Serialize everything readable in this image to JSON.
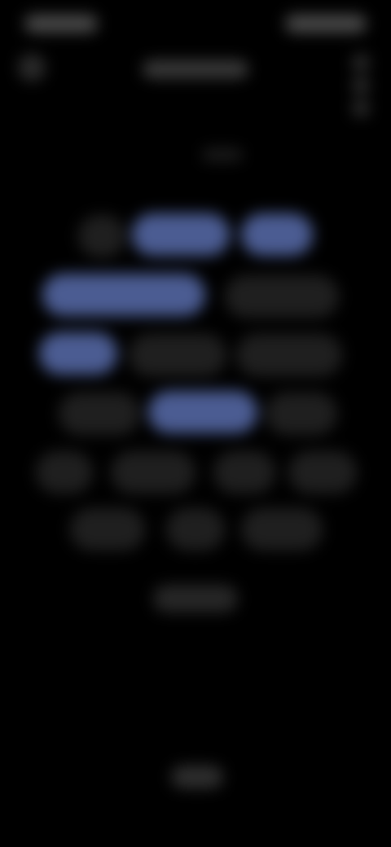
{
  "colors": {
    "background": "#000000",
    "selected_chip": "#4b5c92",
    "unselected_chip": "#1f1f1f"
  },
  "icons": {
    "back": "arrow-left-icon"
  },
  "chips": [
    {
      "state": "unselected"
    },
    {
      "state": "selected"
    },
    {
      "state": "selected"
    },
    {
      "state": "selected"
    },
    {
      "state": "unselected"
    },
    {
      "state": "selected"
    },
    {
      "state": "unselected"
    },
    {
      "state": "unselected"
    },
    {
      "state": "unselected"
    },
    {
      "state": "selected"
    },
    {
      "state": "unselected"
    },
    {
      "state": "unselected"
    },
    {
      "state": "unselected"
    },
    {
      "state": "unselected"
    },
    {
      "state": "unselected"
    },
    {
      "state": "unselected"
    },
    {
      "state": "unselected"
    },
    {
      "state": "unselected"
    }
  ]
}
